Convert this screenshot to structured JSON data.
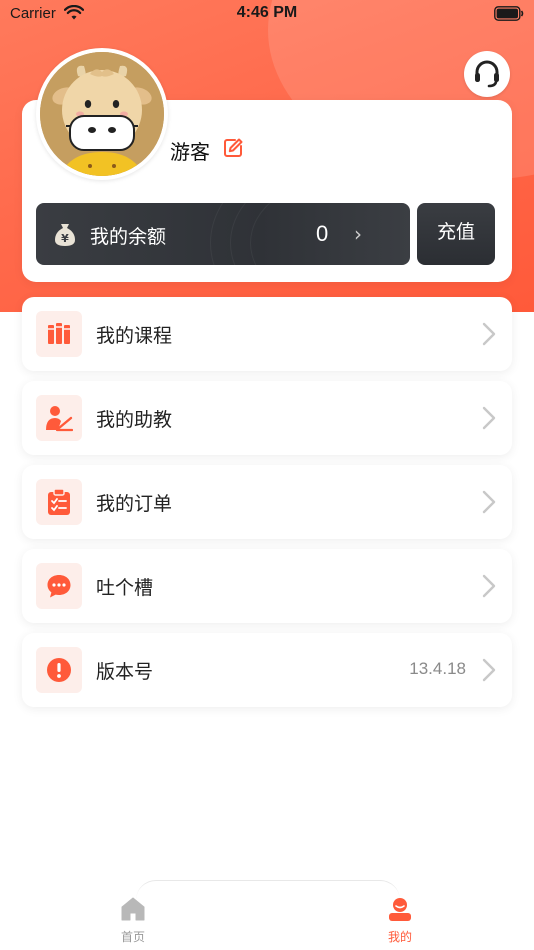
{
  "status_bar": {
    "carrier": "Carrier",
    "time": "4:46 PM"
  },
  "profile": {
    "username": "游客",
    "balance_label": "我的余额",
    "balance_value": "0",
    "recharge_label": "充值"
  },
  "menu": {
    "items": [
      {
        "label": "我的课程",
        "icon": "books-icon"
      },
      {
        "label": "我的助教",
        "icon": "teacher-icon"
      },
      {
        "label": "我的订单",
        "icon": "clipboard-icon"
      },
      {
        "label": "吐个槽",
        "icon": "chat-bubble-icon"
      },
      {
        "label": "版本号",
        "icon": "exclamation-icon",
        "value": "13.4.18"
      }
    ]
  },
  "tab_bar": {
    "tabs": [
      {
        "label": "首页",
        "icon": "home-icon",
        "active": false
      },
      {
        "label": "我的",
        "icon": "user-icon",
        "active": true
      }
    ]
  },
  "colors": {
    "accent": "#ff5a3a",
    "dark_card": "#33363b",
    "icon_bg": "#fdeeea"
  }
}
